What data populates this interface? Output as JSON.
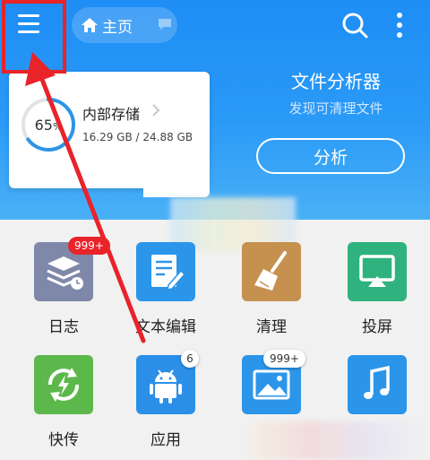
{
  "header": {
    "home_label": "主页",
    "menu_icon": "menu-icon",
    "search_icon": "search-icon",
    "more_icon": "more-vert-icon"
  },
  "storage": {
    "percent_value": "65",
    "percent_sign": "%",
    "title": "内部存储",
    "size": "16.29 GB / 24.88 GB",
    "used_fraction": 0.65
  },
  "analyzer": {
    "title": "文件分析器",
    "subtitle": "发现可清理文件",
    "button": "分析"
  },
  "grid": [
    {
      "label": "日志",
      "icon": "log-icon",
      "badge": "999+",
      "color": "#7f88a8"
    },
    {
      "label": "文本编辑",
      "icon": "text-edit-icon",
      "color": "#2b95e9"
    },
    {
      "label": "清理",
      "icon": "broom-icon",
      "color": "#c6904f"
    },
    {
      "label": "投屏",
      "icon": "cast-icon",
      "color": "#2fb27e"
    },
    {
      "label": "快传",
      "icon": "transfer-icon",
      "color": "#5db84c"
    },
    {
      "label": "应用",
      "icon": "android-icon",
      "badge": "6",
      "color": "#2b8fe8"
    },
    {
      "label": "",
      "icon": "image-icon",
      "badge": "999+",
      "color": "#2b95e9"
    },
    {
      "label": "",
      "icon": "music-icon",
      "color": "#2b95e9"
    }
  ],
  "colors": {
    "accent": "#1e8df5",
    "highlight": "#e8232a"
  }
}
